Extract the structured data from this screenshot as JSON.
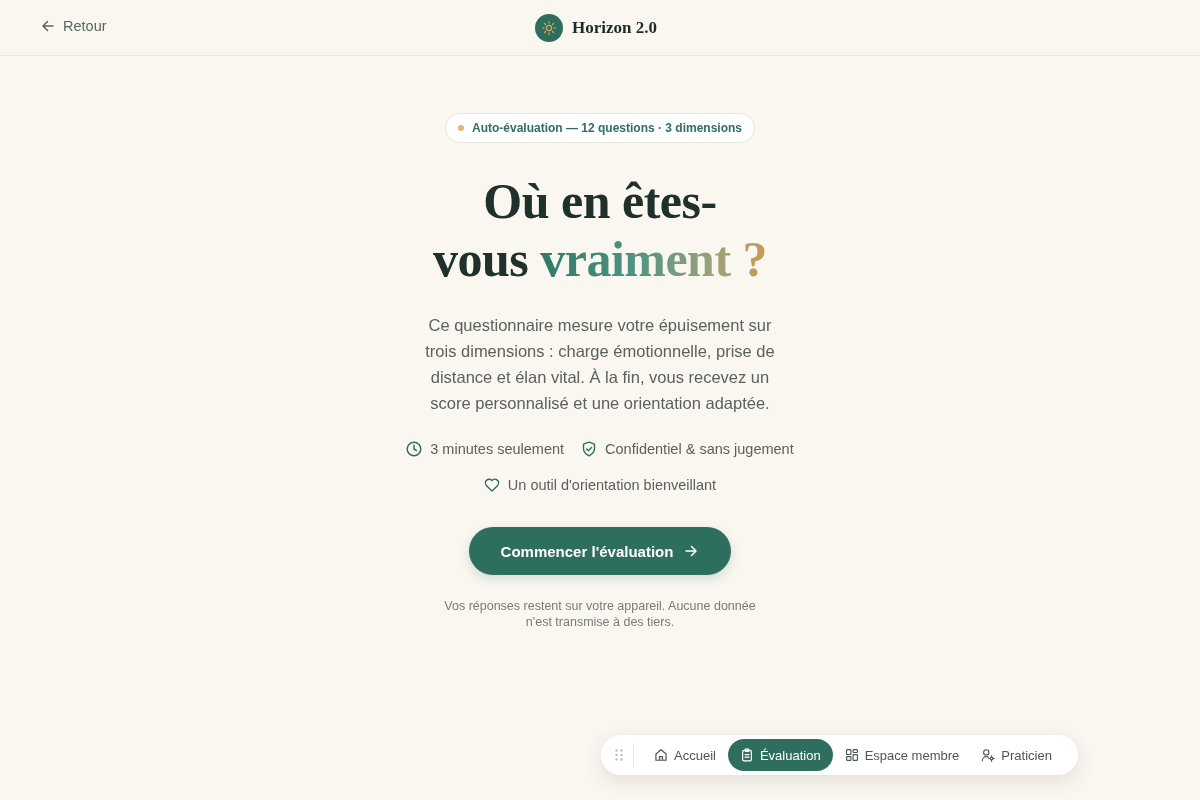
{
  "header": {
    "back_link": "Retour",
    "brand": "Horizon 2.0"
  },
  "badge": "Auto-évaluation — 12 questions · 3 dimensions",
  "title": {
    "line_1": "Où en êtes-",
    "line_2": "vous",
    "accent": "vraiment ?"
  },
  "intro": "Ce questionnaire mesure votre épuisement sur trois dimensions : charge émotionnelle, prise de distance et élan vital. À la fin, vous recevez un score personnalisé et une orientation adaptée.",
  "features": [
    "3 minutes seulement",
    "Confidentiel & sans jugement",
    "Un outil d'orientation bienveillant"
  ],
  "start_button": "Commencer l'évaluation",
  "privacy_note": "Vos réponses restent sur votre appareil. Aucune donnée n'est transmise à des tiers.",
  "bottom_nav": [
    {
      "label": "Accueil",
      "selected": false
    },
    {
      "label": "Évaluation",
      "selected": true
    },
    {
      "label": "Espace membre",
      "selected": false
    },
    {
      "label": "Praticien",
      "selected": false
    }
  ]
}
